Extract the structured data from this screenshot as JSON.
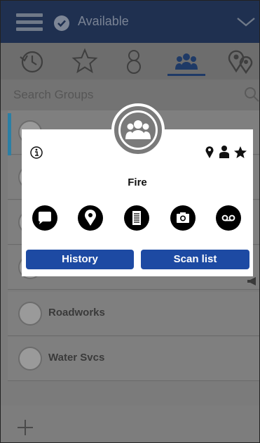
{
  "status": {
    "text": "Available"
  },
  "search": {
    "placeholder": "Search Groups"
  },
  "groups": [
    {
      "label": ""
    },
    {
      "label": ""
    },
    {
      "label": ""
    },
    {
      "label": ""
    },
    {
      "label": "Roadworks"
    },
    {
      "label": "Water Svcs"
    }
  ],
  "popup": {
    "title": "Fire",
    "history_label": "History",
    "scanlist_label": "Scan list"
  },
  "colors": {
    "topbar": "#1f3050",
    "button": "#1d4aa3",
    "accent": "#2a7fa5"
  }
}
